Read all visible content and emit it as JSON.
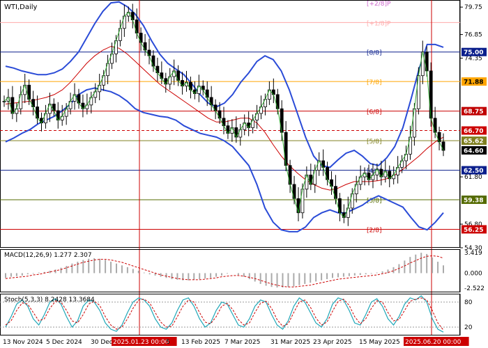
{
  "chart_data": {
    "type": "line",
    "symbol": "WTI,Daily",
    "price_axis": {
      "ylim": [
        54.3,
        80.5
      ],
      "ticks": [
        79.75,
        76.85,
        74.35,
        61.8,
        56.8,
        54.3
      ],
      "highlight_labels": [
        {
          "value": 75.0,
          "text": "75.00",
          "bg": "#0b1f8c",
          "fg": "#ffffff"
        },
        {
          "value": 71.88,
          "text": "71.88",
          "bg": "#ffa500",
          "fg": "#000000"
        },
        {
          "value": 68.75,
          "text": "68.75",
          "bg": "#c00000",
          "fg": "#ffffff"
        },
        {
          "value": 66.7,
          "text": "66.70",
          "bg": "#cc0000",
          "fg": "#ffffff"
        },
        {
          "value": 65.62,
          "text": "65.62",
          "bg": "#808020",
          "fg": "#ffffff"
        },
        {
          "value": 64.6,
          "text": "64.60",
          "bg": "#000000",
          "fg": "#ffffff"
        },
        {
          "value": 62.5,
          "text": "62.50",
          "bg": "#0b1f8c",
          "fg": "#ffffff"
        },
        {
          "value": 59.38,
          "text": "59.38",
          "bg": "#556b00",
          "fg": "#ffffff"
        },
        {
          "value": 56.25,
          "text": "56.25",
          "bg": "#cc0000",
          "fg": "#ffffff"
        }
      ]
    },
    "murrey_levels": [
      {
        "label": "[+2/8]P",
        "value": 81.25,
        "color": "#cc66cc"
      },
      {
        "label": "[+1/8]P",
        "value": 78.12,
        "color": "#ffaaaa"
      },
      {
        "label": "[8/8]",
        "value": 75.0,
        "color": "#0b1f8c"
      },
      {
        "label": "[7/8]",
        "value": 71.88,
        "color": "#ffa500"
      },
      {
        "label": "[6/8]",
        "value": 68.75,
        "color": "#cc0000"
      },
      {
        "label": "[5/8]",
        "value": 65.62,
        "color": "#808020"
      },
      {
        "label": "[4/8]",
        "value": 62.5,
        "color": "#0b1f8c"
      },
      {
        "label": "[3/8]",
        "value": 59.38,
        "color": "#556b00"
      },
      {
        "label": "[2/8]",
        "value": 56.25,
        "color": "#cc0000"
      }
    ],
    "dashed_level": {
      "value": 66.7,
      "color": "#cc0000"
    },
    "x_labels": [
      "13 Nov 2024",
      "5 Dec 2024",
      "30 Dec",
      "2025.01.23 00:00",
      "5",
      "13 Feb 2025",
      "7 Mar 2025",
      "31 Mar 2025",
      "23 Apr 2025",
      "15 May 2025",
      "2025.06.20 00:00"
    ],
    "x_label_highlight": [
      "2025.01.23 00:00",
      "2025.06.20 00:00"
    ],
    "close_prices": [
      69.8,
      70.2,
      68.5,
      69.0,
      70.5,
      71.5,
      70.0,
      69.2,
      68.0,
      67.5,
      68.5,
      69.5,
      68.8,
      67.8,
      68.2,
      69.0,
      69.8,
      70.5,
      69.6,
      69.0,
      69.4,
      70.2,
      70.8,
      71.5,
      72.5,
      73.8,
      74.8,
      76.2,
      77.5,
      78.8,
      79.2,
      78.4,
      77.0,
      76.0,
      75.2,
      74.6,
      73.5,
      72.8,
      72.2,
      71.6,
      72.4,
      73.0,
      72.0,
      71.4,
      71.8,
      71.0,
      70.6,
      71.4,
      71.0,
      70.2,
      69.4,
      68.8,
      68.0,
      67.2,
      66.4,
      67.0,
      66.0,
      66.8,
      67.5,
      67.0,
      67.8,
      68.5,
      69.2,
      70.0,
      71.0,
      70.5,
      69.0,
      66.5,
      63.0,
      61.0,
      59.5,
      58.0,
      60.5,
      62.0,
      61.0,
      62.5,
      63.5,
      62.8,
      61.5,
      60.8,
      59.5,
      58.0,
      57.5,
      58.5,
      60.0,
      61.0,
      61.8,
      62.2,
      61.5,
      62.0,
      62.6,
      61.8,
      62.4,
      61.6,
      62.0,
      62.8,
      63.5,
      64.2,
      66.0,
      69.0,
      72.5,
      75.0,
      73.0,
      68.0,
      66.5,
      65.5,
      64.6
    ],
    "bollinger": {
      "upper": [
        73.5,
        73.3,
        73.0,
        72.8,
        72.6,
        72.6,
        72.8,
        73.2,
        74.0,
        75.0,
        76.5,
        78.0,
        79.3,
        80.2,
        80.3,
        79.8,
        79.0,
        77.8,
        76.2,
        74.8,
        73.8,
        73.2,
        72.6,
        71.6,
        70.5,
        69.6,
        69.2,
        69.6,
        70.5,
        71.8,
        72.8,
        74.0,
        74.6,
        74.2,
        73.0,
        71.0,
        68.5,
        66.0,
        64.0,
        63.0,
        62.8,
        63.6,
        64.3,
        64.6,
        64.0,
        63.2,
        63.0,
        63.8,
        65.0,
        67.0,
        70.0,
        73.2,
        75.8,
        75.8,
        75.5
      ],
      "middle": [
        69.5,
        69.6,
        69.7,
        69.8,
        70.0,
        70.2,
        70.5,
        71.0,
        71.8,
        72.8,
        73.8,
        74.6,
        75.2,
        75.6,
        75.4,
        74.8,
        74.0,
        73.2,
        72.4,
        71.6,
        71.0,
        70.4,
        69.8,
        69.2,
        68.6,
        68.0,
        67.6,
        67.6,
        67.8,
        68.0,
        68.0,
        67.5,
        66.5,
        65.2,
        64.0,
        63.0,
        62.2,
        61.5,
        61.0,
        60.6,
        60.4,
        60.6,
        61.0,
        61.3,
        61.3,
        61.3,
        61.4,
        61.6,
        62.0,
        62.6,
        63.3,
        64.0,
        64.8,
        65.5,
        66.0
      ],
      "lower": [
        65.5,
        65.9,
        66.4,
        66.8,
        67.4,
        67.8,
        68.2,
        68.8,
        69.5,
        70.5,
        71.0,
        71.2,
        71.0,
        70.8,
        70.4,
        69.8,
        69.0,
        68.6,
        68.4,
        68.2,
        68.1,
        67.8,
        67.2,
        66.8,
        66.4,
        66.2,
        66.0,
        65.6,
        65.0,
        64.0,
        63.0,
        61.0,
        58.5,
        57.0,
        56.2,
        56.0,
        56.0,
        56.5,
        57.5,
        58.0,
        58.3,
        58.0,
        58.0,
        58.4,
        58.8,
        59.4,
        59.8,
        59.4,
        59.0,
        58.6,
        57.5,
        56.5,
        56.2,
        57.0,
        58.0
      ]
    },
    "macd": {
      "label": "MACD(12,26,9) 1.277 2.307",
      "ticks": [
        3.419,
        0.0,
        -2.522
      ],
      "ylim": [
        -3.2,
        4.0
      ],
      "histogram": [
        -0.8,
        -0.6,
        -0.5,
        -0.4,
        -0.2,
        -0.1,
        0.1,
        0.2,
        0.4,
        0.6,
        0.9,
        1.2,
        1.6,
        1.9,
        2.2,
        2.4,
        2.5,
        2.4,
        2.2,
        1.9,
        1.6,
        1.3,
        1.0,
        0.7,
        0.4,
        0.1,
        -0.2,
        -0.4,
        -0.6,
        -0.8,
        -1.0,
        -1.1,
        -1.2,
        -1.2,
        -1.1,
        -1.0,
        -0.9,
        -0.8,
        -0.6,
        -0.4,
        -0.1,
        0.0,
        -0.3,
        -0.6,
        -1.0,
        -1.4,
        -1.8,
        -2.1,
        -2.3,
        -2.4,
        -2.4,
        -2.3,
        -2.2,
        -2.0,
        -1.8,
        -1.6,
        -1.4,
        -1.2,
        -1.0,
        -0.8,
        -0.7,
        -0.6,
        -0.5,
        -0.4,
        -0.3,
        -0.2,
        -0.1,
        0.1,
        0.3,
        0.6,
        1.0,
        1.5,
        2.1,
        2.7,
        3.1,
        3.4,
        3.2,
        2.6,
        1.9,
        1.3
      ],
      "signal": [
        -0.9,
        -0.8,
        -0.7,
        -0.6,
        -0.5,
        -0.3,
        -0.2,
        0.0,
        0.2,
        0.4,
        0.6,
        0.9,
        1.2,
        1.5,
        1.8,
        2.0,
        2.2,
        2.3,
        2.3,
        2.2,
        2.0,
        1.8,
        1.5,
        1.2,
        0.9,
        0.6,
        0.3,
        0.0,
        -0.3,
        -0.5,
        -0.7,
        -0.9,
        -1.0,
        -1.1,
        -1.1,
        -1.1,
        -1.0,
        -0.9,
        -0.8,
        -0.6,
        -0.5,
        -0.4,
        -0.4,
        -0.5,
        -0.7,
        -0.9,
        -1.2,
        -1.5,
        -1.8,
        -2.0,
        -2.2,
        -2.3,
        -2.3,
        -2.2,
        -2.1,
        -2.0,
        -1.8,
        -1.6,
        -1.4,
        -1.2,
        -1.0,
        -0.9,
        -0.8,
        -0.7,
        -0.6,
        -0.5,
        -0.4,
        -0.3,
        -0.1,
        0.1,
        0.4,
        0.8,
        1.2,
        1.7,
        2.1,
        2.5,
        2.8,
        2.9,
        2.8,
        2.5
      ]
    },
    "stoch": {
      "label": "Stoch(5,3,3) 8.2428 13.3684",
      "ticks": [
        80,
        20
      ],
      "ylim": [
        0,
        100
      ],
      "main": [
        20,
        45,
        75,
        85,
        70,
        40,
        25,
        50,
        80,
        88,
        75,
        45,
        20,
        35,
        70,
        85,
        80,
        60,
        30,
        15,
        10,
        25,
        55,
        80,
        90,
        85,
        70,
        40,
        20,
        15,
        30,
        60,
        85,
        90,
        70,
        40,
        20,
        30,
        60,
        80,
        75,
        50,
        25,
        20,
        40,
        70,
        85,
        80,
        50,
        25,
        15,
        35,
        70,
        90,
        80,
        55,
        30,
        20,
        40,
        75,
        90,
        85,
        60,
        30,
        25,
        50,
        80,
        88,
        70,
        40,
        25,
        45,
        75,
        90,
        85,
        95,
        80,
        40,
        15,
        8
      ],
      "signal": [
        25,
        35,
        60,
        78,
        75,
        55,
        35,
        40,
        65,
        82,
        80,
        60,
        35,
        30,
        50,
        75,
        82,
        72,
        45,
        25,
        15,
        20,
        40,
        65,
        85,
        87,
        78,
        55,
        32,
        20,
        22,
        45,
        70,
        85,
        80,
        55,
        32,
        28,
        45,
        70,
        77,
        62,
        38,
        25,
        30,
        55,
        77,
        82,
        65,
        38,
        22,
        28,
        55,
        80,
        85,
        68,
        42,
        25,
        32,
        58,
        82,
        87,
        72,
        45,
        28,
        40,
        65,
        83,
        80,
        55,
        35,
        38,
        60,
        82,
        87,
        90,
        85,
        60,
        30,
        13
      ]
    }
  }
}
